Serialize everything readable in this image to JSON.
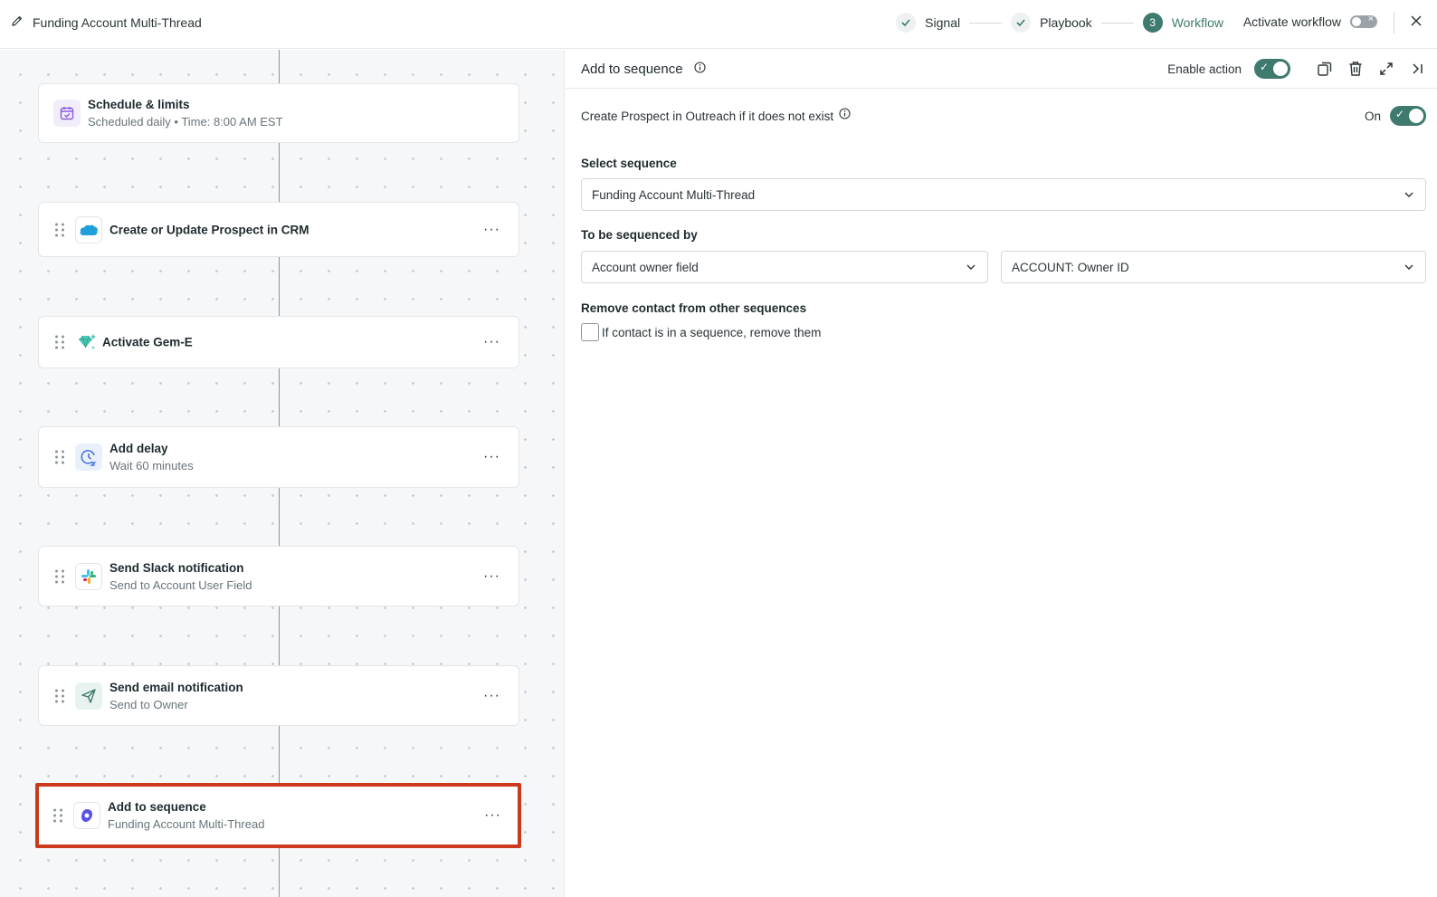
{
  "header": {
    "title": "Funding Account Multi-Thread",
    "steps": [
      {
        "label": "Signal",
        "state": "done"
      },
      {
        "label": "Playbook",
        "state": "done"
      },
      {
        "label": "Workflow",
        "state": "active",
        "number": "3"
      }
    ],
    "activate_label": "Activate workflow",
    "activate_on": false
  },
  "nodes": [
    {
      "title": "Schedule & limits",
      "subtitle": "Scheduled daily • Time: 8:00 AM EST",
      "icon": "calendar-icon"
    },
    {
      "title": "Create or Update Prospect in CRM",
      "subtitle": "",
      "icon": "salesforce-cloud-icon"
    },
    {
      "title": "Activate Gem-E",
      "subtitle": "",
      "icon": "gem-sparkle-icon"
    },
    {
      "title": "Add delay",
      "subtitle": "Wait 60 minutes",
      "icon": "clock-icon"
    },
    {
      "title": "Send Slack notification",
      "subtitle": "Send to Account User Field",
      "icon": "slack-icon"
    },
    {
      "title": "Send email notification",
      "subtitle": "Send to Owner",
      "icon": "send-icon"
    },
    {
      "title": "Add to sequence",
      "subtitle": "Funding Account Multi-Thread",
      "icon": "outreach-icon",
      "selected": true
    }
  ],
  "panel": {
    "title": "Add to sequence",
    "enable_label": "Enable action",
    "enable_on": true,
    "create_prospect_label": "Create Prospect in Outreach if it does not exist",
    "create_prospect_state": "On",
    "select_sequence_label": "Select sequence",
    "select_sequence_value": "Funding Account Multi-Thread",
    "sequenced_by_label": "To be sequenced by",
    "sequenced_by_value": "Account owner field",
    "owner_field_value": "ACCOUNT: Owner ID",
    "remove_label": "Remove contact from other sequences",
    "remove_checkbox_label": "If contact is in a sequence, remove them",
    "remove_checked": false
  },
  "colors": {
    "accent": "#3e7a6e",
    "selected_border": "#cc3a1d",
    "outreach": "#5951e0"
  }
}
